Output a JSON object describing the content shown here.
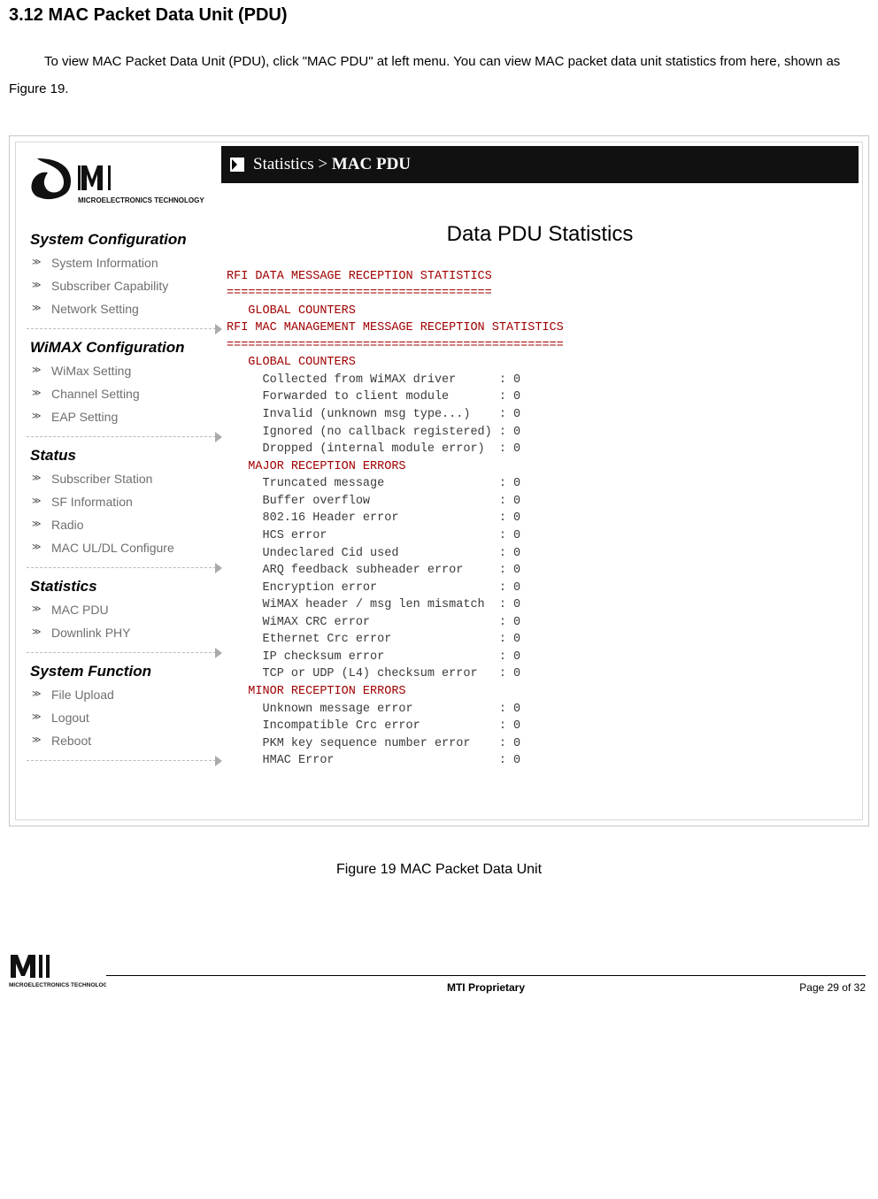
{
  "section_heading": "3.12  MAC Packet Data Unit (PDU)",
  "intro_text": "To view MAC Packet Data Unit (PDU), click \"MAC PDU\" at left menu. You can view MAC packet data unit statistics from here, shown as Figure 19.",
  "logo_text": "MICROELECTRONICS TECHNOLOGY INC.",
  "titlebar": {
    "part1": "Statistics >",
    "part2": "MAC PDU"
  },
  "content_heading": "Data PDU Statistics",
  "chart_data": {
    "type": "table",
    "title": "Data PDU Statistics",
    "sections": [
      {
        "header": "RFI DATA MESSAGE RECEPTION STATISTICS",
        "rule": "=====================================",
        "subhead": "GLOBAL COUNTERS",
        "rows": []
      },
      {
        "header": "RFI MAC MANAGEMENT MESSAGE RECEPTION STATISTICS",
        "rule": "===============================================",
        "groups": [
          {
            "name": "GLOBAL COUNTERS",
            "rows": [
              {
                "label": "Collected from WiMAX driver",
                "value": 0
              },
              {
                "label": "Forwarded to client module",
                "value": 0
              },
              {
                "label": "Invalid (unknown msg type...)",
                "value": 0
              },
              {
                "label": "Ignored (no callback registered)",
                "value": 0
              },
              {
                "label": "Dropped (internal module error)",
                "value": 0
              }
            ]
          },
          {
            "name": "MAJOR RECEPTION ERRORS",
            "rows": [
              {
                "label": "Truncated message",
                "value": 0
              },
              {
                "label": "Buffer overflow",
                "value": 0
              },
              {
                "label": "802.16 Header error",
                "value": 0
              },
              {
                "label": "HCS error",
                "value": 0
              },
              {
                "label": "Undeclared Cid used",
                "value": 0
              },
              {
                "label": "ARQ feedback subheader error",
                "value": 0
              },
              {
                "label": "Encryption error",
                "value": 0
              },
              {
                "label": "WiMAX header / msg len mismatch",
                "value": 0
              },
              {
                "label": "WiMAX CRC error",
                "value": 0
              },
              {
                "label": "Ethernet Crc error",
                "value": 0
              },
              {
                "label": "IP checksum error",
                "value": 0
              },
              {
                "label": "TCP or UDP (L4) checksum error",
                "value": 0
              }
            ]
          },
          {
            "name": "MINOR RECEPTION ERRORS",
            "rows": [
              {
                "label": "Unknown message error",
                "value": 0
              },
              {
                "label": "Incompatible Crc error",
                "value": 0
              },
              {
                "label": "PKM key sequence number error",
                "value": 0
              },
              {
                "label": "HMAC Error",
                "value": 0
              }
            ]
          }
        ]
      }
    ]
  },
  "menu": [
    {
      "title": "System Configuration",
      "items": [
        "System Information",
        "Subscriber Capability",
        "Network Setting"
      ]
    },
    {
      "title": "WiMAX Configuration",
      "items": [
        "WiMax Setting",
        "Channel Setting",
        "EAP Setting"
      ]
    },
    {
      "title": "Status",
      "items": [
        "Subscriber Station",
        "SF Information",
        "Radio",
        "MAC UL/DL Configure"
      ]
    },
    {
      "title": "Statistics",
      "items": [
        "MAC PDU",
        "Downlink PHY"
      ]
    },
    {
      "title": "System Function",
      "items": [
        "File Upload",
        "Logout",
        "Reboot"
      ]
    }
  ],
  "fig_caption": "Figure 19    MAC Packet Data Unit",
  "footer": {
    "proprietary": "MTI Proprietary",
    "page": "Page 29 of 32"
  }
}
